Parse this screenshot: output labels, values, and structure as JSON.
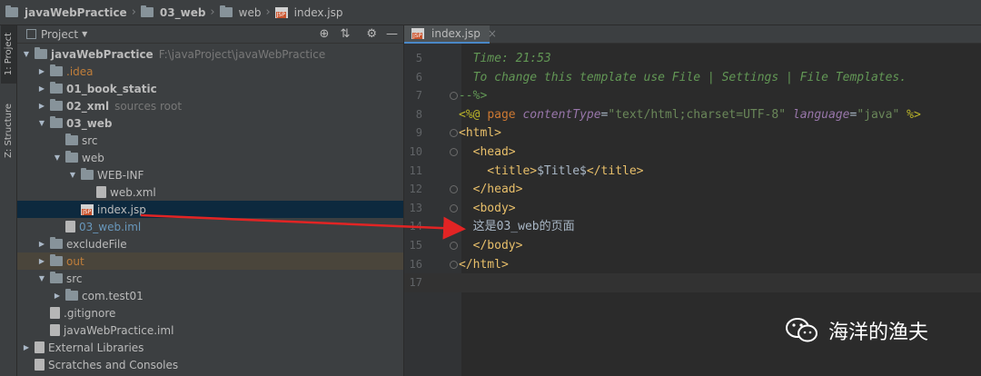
{
  "breadcrumbs": [
    "javaWebPractice",
    "03_web",
    "web",
    "index.jsp"
  ],
  "side_tabs": [
    "1: Project",
    "Z: Structure"
  ],
  "project_panel": {
    "title": "Project"
  },
  "tree": [
    {
      "label": "javaWebPractice",
      "suffix": "F:\\javaProject\\javaWebPractice",
      "depth": 0,
      "arrow": "down",
      "icon": "folder-icon",
      "bold": true
    },
    {
      "label": ".idea",
      "suffix": "",
      "depth": 1,
      "arrow": "right",
      "icon": "folder-icon",
      "color": "#c07e3a"
    },
    {
      "label": "01_book_static",
      "suffix": "",
      "depth": 1,
      "arrow": "right",
      "icon": "folder-icon",
      "bold": true
    },
    {
      "label": "02_xml",
      "suffix": "sources root",
      "depth": 1,
      "arrow": "right",
      "icon": "folder-icon",
      "bold": true
    },
    {
      "label": "03_web",
      "suffix": "",
      "depth": 1,
      "arrow": "down",
      "icon": "folder-icon",
      "bold": true
    },
    {
      "label": "src",
      "suffix": "",
      "depth": 2,
      "arrow": "",
      "icon": "folder-icon"
    },
    {
      "label": "web",
      "suffix": "",
      "depth": 2,
      "arrow": "down",
      "icon": "folder-icon"
    },
    {
      "label": "WEB-INF",
      "suffix": "",
      "depth": 3,
      "arrow": "down",
      "icon": "folder-icon"
    },
    {
      "label": "web.xml",
      "suffix": "",
      "depth": 4,
      "arrow": "",
      "icon": "file-icon"
    },
    {
      "label": "index.jsp",
      "suffix": "",
      "depth": 3,
      "arrow": "",
      "icon": "jsp-icon",
      "selected": true
    },
    {
      "label": "03_web.iml",
      "suffix": "",
      "depth": 2,
      "arrow": "",
      "icon": "file-icon",
      "color": "#6897bb"
    },
    {
      "label": "excludeFile",
      "suffix": "",
      "depth": 1,
      "arrow": "right",
      "icon": "folder-icon"
    },
    {
      "label": "out",
      "suffix": "",
      "depth": 1,
      "arrow": "right",
      "icon": "folder-icon",
      "color": "#c07e3a",
      "excluded": true
    },
    {
      "label": "src",
      "suffix": "",
      "depth": 1,
      "arrow": "down",
      "icon": "folder-icon"
    },
    {
      "label": "com.test01",
      "suffix": "",
      "depth": 2,
      "arrow": "right",
      "icon": "folder-icon"
    },
    {
      "label": ".gitignore",
      "suffix": "",
      "depth": 1,
      "arrow": "",
      "icon": "file-icon"
    },
    {
      "label": "javaWebPractice.iml",
      "suffix": "",
      "depth": 1,
      "arrow": "",
      "icon": "file-icon"
    },
    {
      "label": "External Libraries",
      "suffix": "",
      "depth": 0,
      "arrow": "right",
      "icon": "library-icon"
    },
    {
      "label": "Scratches and Consoles",
      "suffix": "",
      "depth": 0,
      "arrow": "",
      "icon": "scratches-icon"
    }
  ],
  "editor": {
    "tab": "index.jsp",
    "lines": [
      {
        "n": "5",
        "parts": [
          {
            "t": "  Time: 21:53",
            "c": "cm"
          }
        ]
      },
      {
        "n": "6",
        "parts": [
          {
            "t": "  To change this template use File | Settings | File Templates.",
            "c": "cm"
          }
        ]
      },
      {
        "n": "7",
        "parts": [
          {
            "t": "--%>",
            "c": "cm"
          }
        ]
      },
      {
        "n": "8",
        "parts": [
          {
            "t": "<%@ ",
            "c": "dir"
          },
          {
            "t": "page ",
            "c": "kw"
          },
          {
            "t": "contentType",
            "c": "attr"
          },
          {
            "t": "=",
            "c": ""
          },
          {
            "t": "\"text/html;charset=UTF-8\"",
            "c": "str"
          },
          {
            "t": " ",
            "c": ""
          },
          {
            "t": "language",
            "c": "attr"
          },
          {
            "t": "=",
            "c": ""
          },
          {
            "t": "\"java\"",
            "c": "str"
          },
          {
            "t": " %>",
            "c": "dir"
          }
        ]
      },
      {
        "n": "9",
        "parts": [
          {
            "t": "<html>",
            "c": "tag"
          }
        ]
      },
      {
        "n": "10",
        "parts": [
          {
            "t": "  <head>",
            "c": "tag"
          }
        ]
      },
      {
        "n": "11",
        "parts": [
          {
            "t": "    <title>",
            "c": "tag"
          },
          {
            "t": "$Title$",
            "c": ""
          },
          {
            "t": "</title>",
            "c": "tag"
          }
        ]
      },
      {
        "n": "12",
        "parts": [
          {
            "t": "  </head>",
            "c": "tag"
          }
        ]
      },
      {
        "n": "13",
        "parts": [
          {
            "t": "  <body>",
            "c": "tag"
          }
        ]
      },
      {
        "n": "14",
        "parts": [
          {
            "t": "  这是03_web的页面",
            "c": ""
          }
        ]
      },
      {
        "n": "15",
        "parts": [
          {
            "t": "  </body>",
            "c": "tag"
          }
        ]
      },
      {
        "n": "16",
        "parts": [
          {
            "t": "</html>",
            "c": "tag"
          }
        ]
      },
      {
        "n": "17",
        "parts": []
      }
    ]
  },
  "watermark": "海洋的渔夫"
}
